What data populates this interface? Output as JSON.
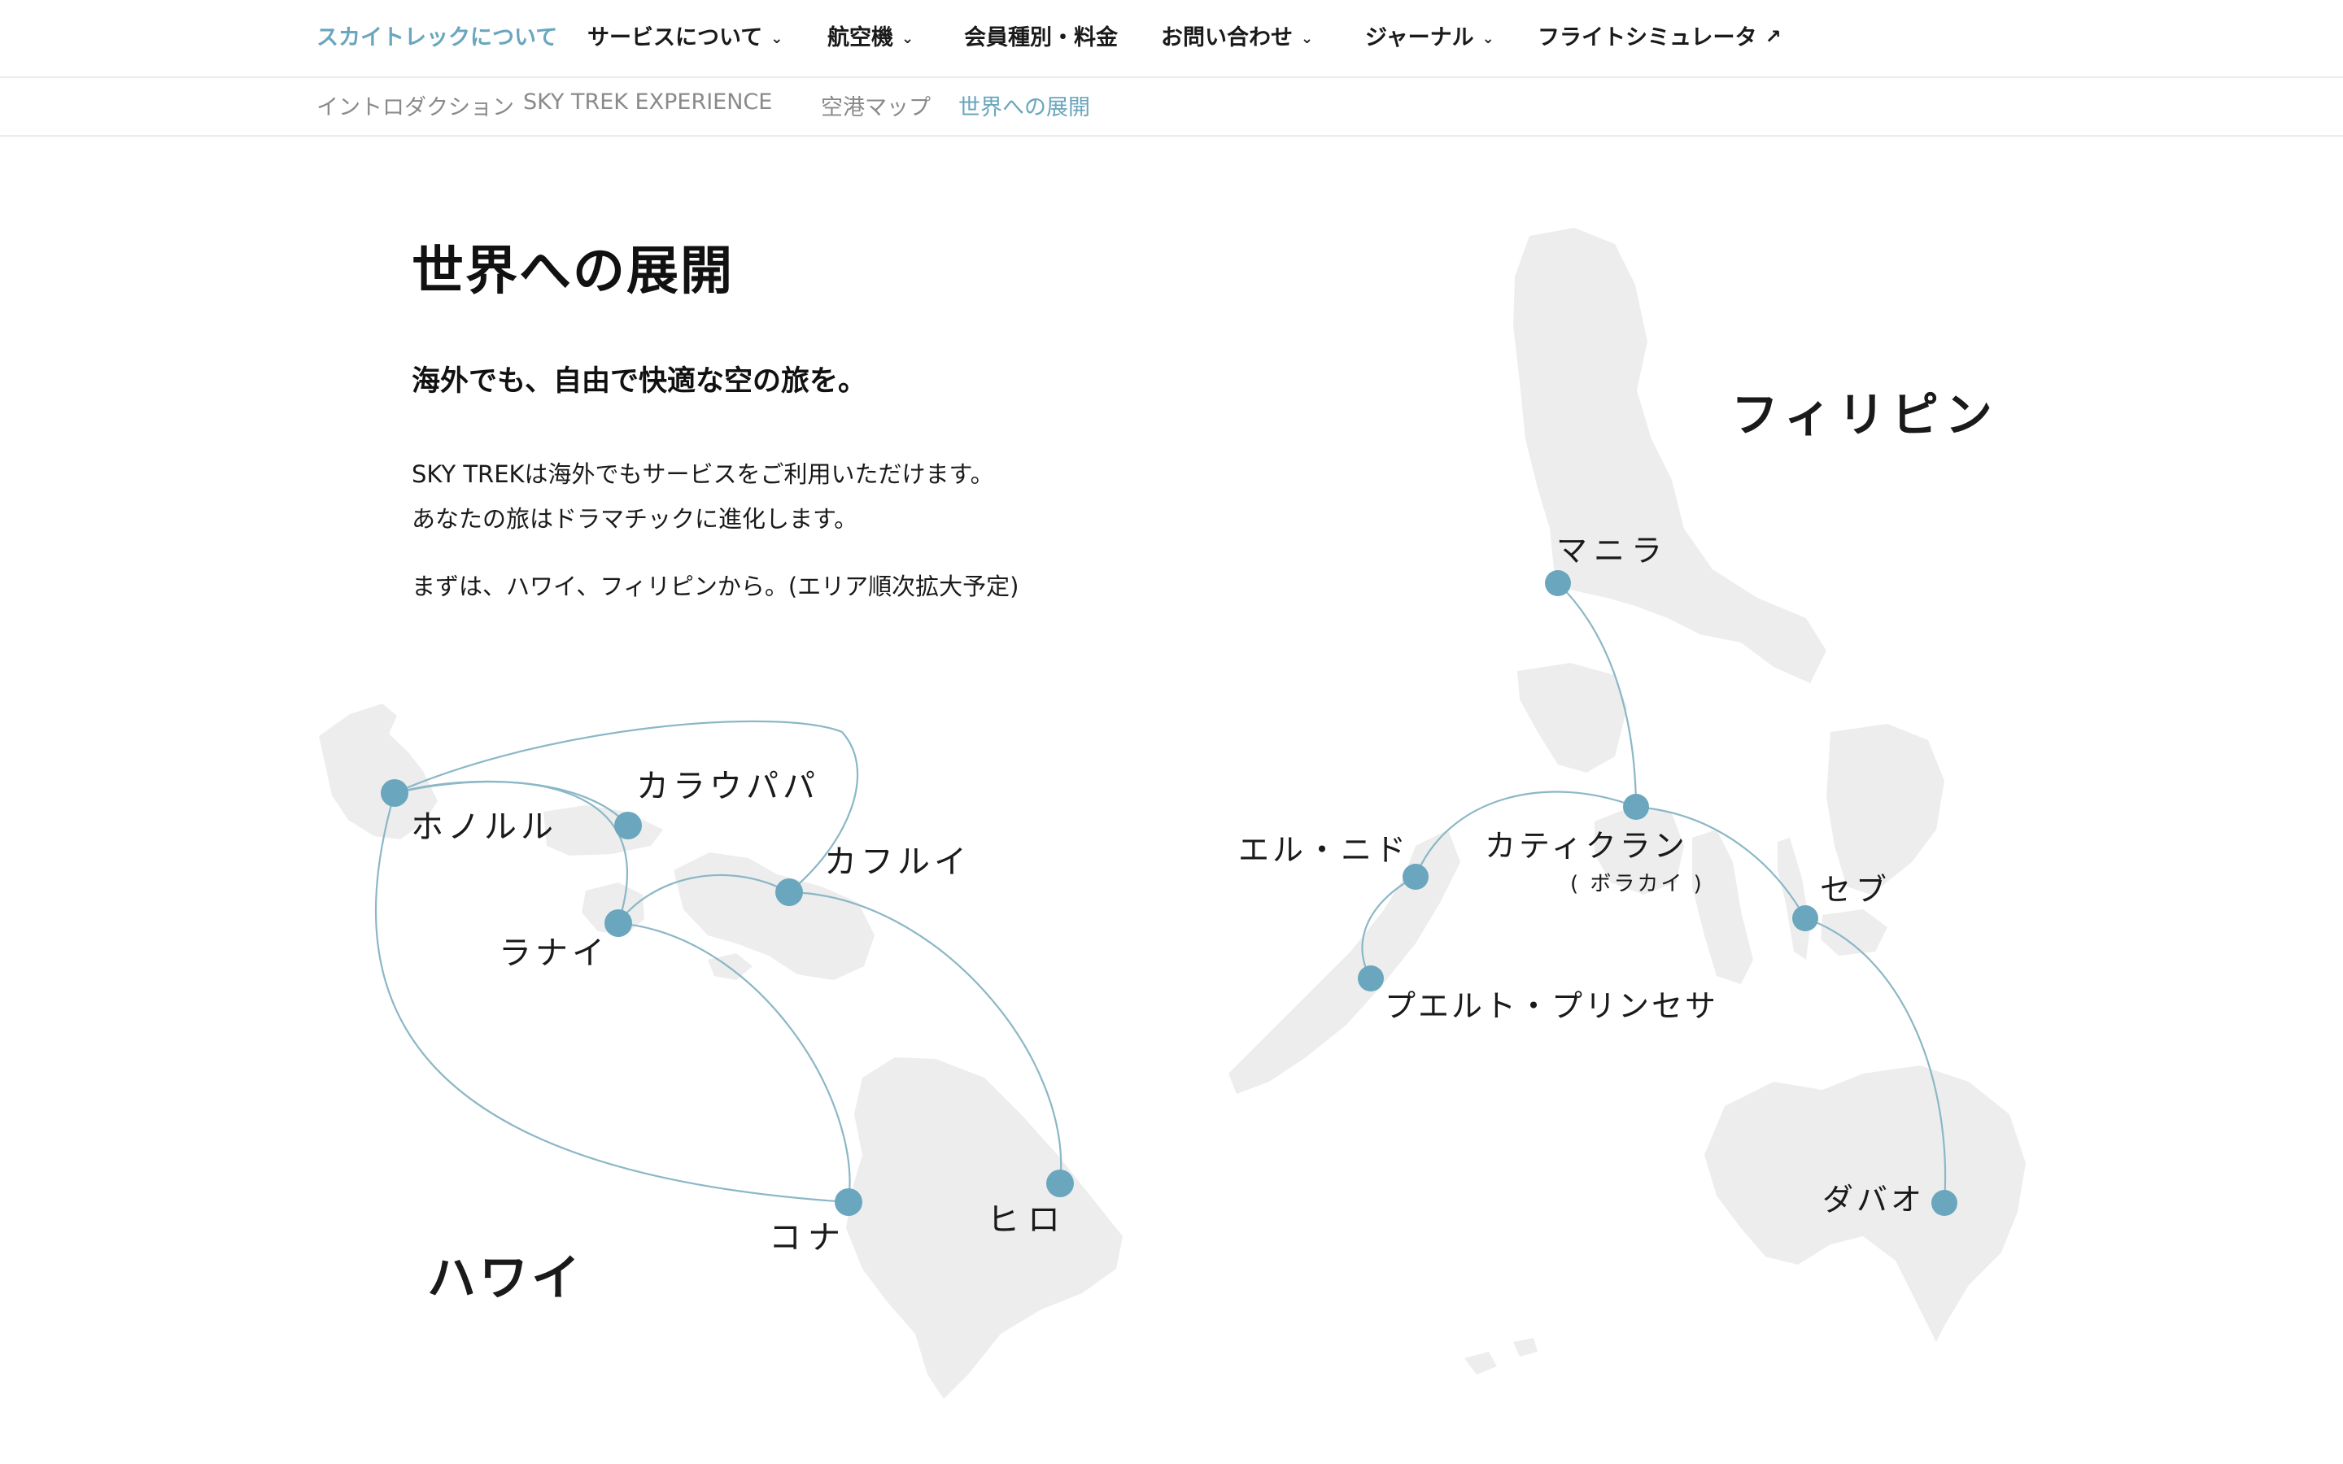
{
  "nav": {
    "items": [
      {
        "label": "スカイトレックについて",
        "active": true,
        "dropdown": false
      },
      {
        "label": "サービスについて",
        "active": false,
        "dropdown": true
      },
      {
        "label": "航空機",
        "active": false,
        "dropdown": true
      },
      {
        "label": "会員種別・料金",
        "active": false,
        "dropdown": false
      },
      {
        "label": "お問い合わせ",
        "active": false,
        "dropdown": true
      },
      {
        "label": "ジャーナル",
        "active": false,
        "dropdown": true
      },
      {
        "label": "フライトシミュレータ",
        "active": false,
        "external": true
      }
    ],
    "dropdown_glyph": "⌄",
    "external_glyph": "↗"
  },
  "subnav": {
    "items": [
      {
        "label": "イントロダクション",
        "active": false
      },
      {
        "label": "SKY TREK EXPERIENCE",
        "active": false
      },
      {
        "label": "空港マップ",
        "active": false
      },
      {
        "label": "世界への展開",
        "active": true
      }
    ]
  },
  "section": {
    "title": "世界への展開",
    "subtitle": "海外でも、自由で快適な空の旅を。",
    "paragraph_line1": "SKY TREKは海外でもサービスをご利用いただけます。",
    "paragraph_line2": "あなたの旅はドラマチックに進化します。",
    "note": "まずは、ハワイ、フィリピンから。(エリア順次拡大予定)"
  },
  "hawaii": {
    "region_label": "ハワイ",
    "airports": {
      "honolulu": "ホノルル",
      "kalaupapa": "カラウパパ",
      "kahului": "カフルイ",
      "lanai": "ラナイ",
      "kona": "コナ",
      "hilo": "ヒロ"
    }
  },
  "philippines": {
    "region_label": "フィリピン",
    "airports": {
      "manila": "マニラ",
      "elnido": "エル・ニド",
      "caticlan": "カティクラン",
      "caticlan_sub": "( ボラカイ )",
      "cebu": "セブ",
      "puerto": "プエルト・プリンセサ",
      "davao": "ダバオ"
    }
  },
  "colors": {
    "accent": "#6aa6bd",
    "route": "#8bb7c6",
    "land": "#ededed",
    "text": "#1a1a1a",
    "muted": "#8a8a8a"
  }
}
